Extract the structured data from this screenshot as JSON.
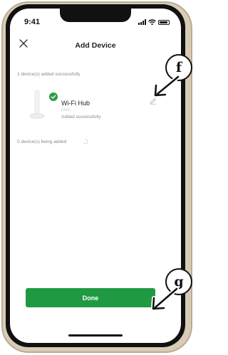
{
  "status_bar": {
    "time": "9:41"
  },
  "header": {
    "title": "Add Device",
    "close_icon": "close-icon"
  },
  "added_section": {
    "label": "1 device(s) added successfully"
  },
  "device": {
    "name": "Wi-Fi Hub",
    "room": "Main",
    "status": "Added successfully",
    "badge_icon": "check-icon",
    "accent_color": "#2e9d45"
  },
  "pending_section": {
    "label": "0 device(s) being added"
  },
  "done_button": {
    "label": "Done",
    "color": "#1f9a42"
  },
  "callouts": {
    "f": "f",
    "g": "g"
  }
}
